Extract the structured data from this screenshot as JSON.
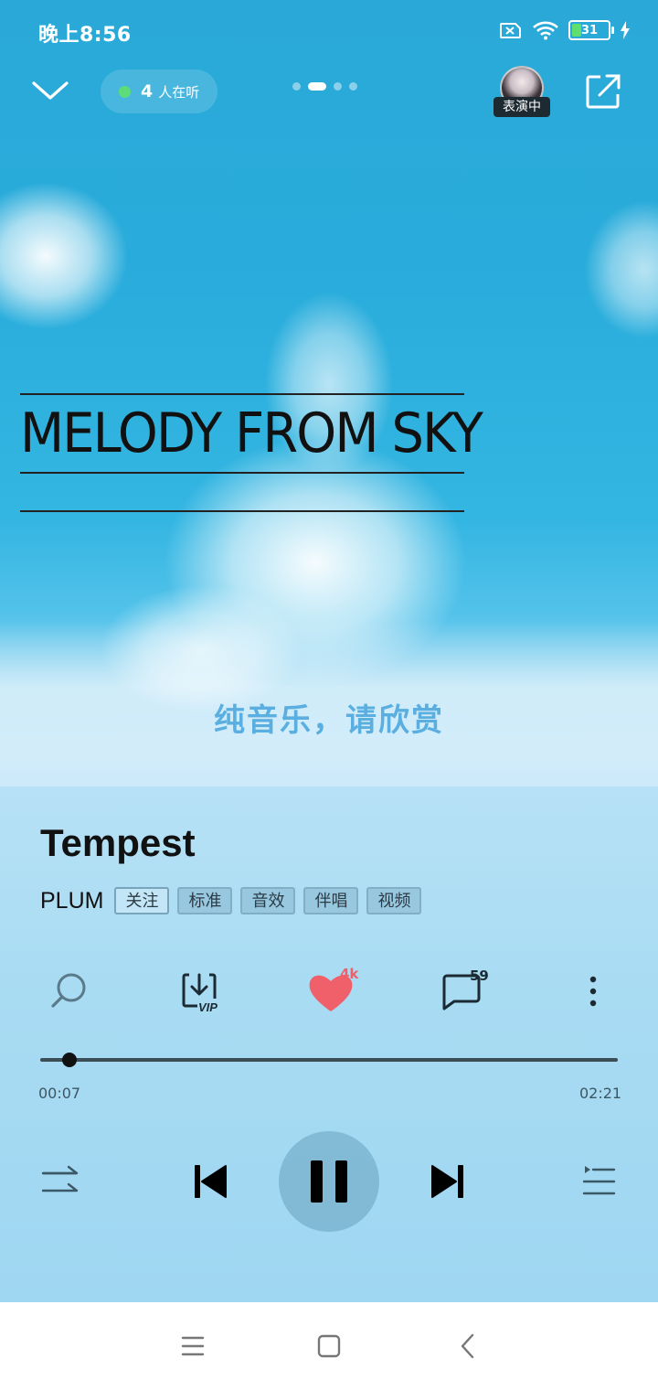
{
  "status_bar": {
    "time": "晚上8:56",
    "battery": "31"
  },
  "header": {
    "listeners_count": "4",
    "listeners_label": "人在听",
    "performer_badge": "表演中"
  },
  "album_art": {
    "title": "MELODY FROM SKY"
  },
  "lyric": "纯音乐，请欣赏",
  "song": {
    "title": "Tempest",
    "artist": "PLUM",
    "tags": [
      "关注",
      "标准",
      "音效",
      "伴唱",
      "视频"
    ]
  },
  "actions": {
    "like_count": "4k",
    "comment_count": "59"
  },
  "progress": {
    "elapsed": "00:07",
    "total": "02:21",
    "fraction": 0.05
  },
  "colors": {
    "accent_heart": "#f0606a",
    "sky": "#2aa9d8"
  },
  "icons": [
    "chevron-down-icon",
    "share-icon",
    "search-icon",
    "download-vip-icon",
    "heart-icon",
    "comment-icon",
    "more-icon",
    "shuffle-icon",
    "previous-icon",
    "pause-icon",
    "next-icon",
    "playlist-icon",
    "menu-icon",
    "home-icon",
    "back-icon"
  ]
}
